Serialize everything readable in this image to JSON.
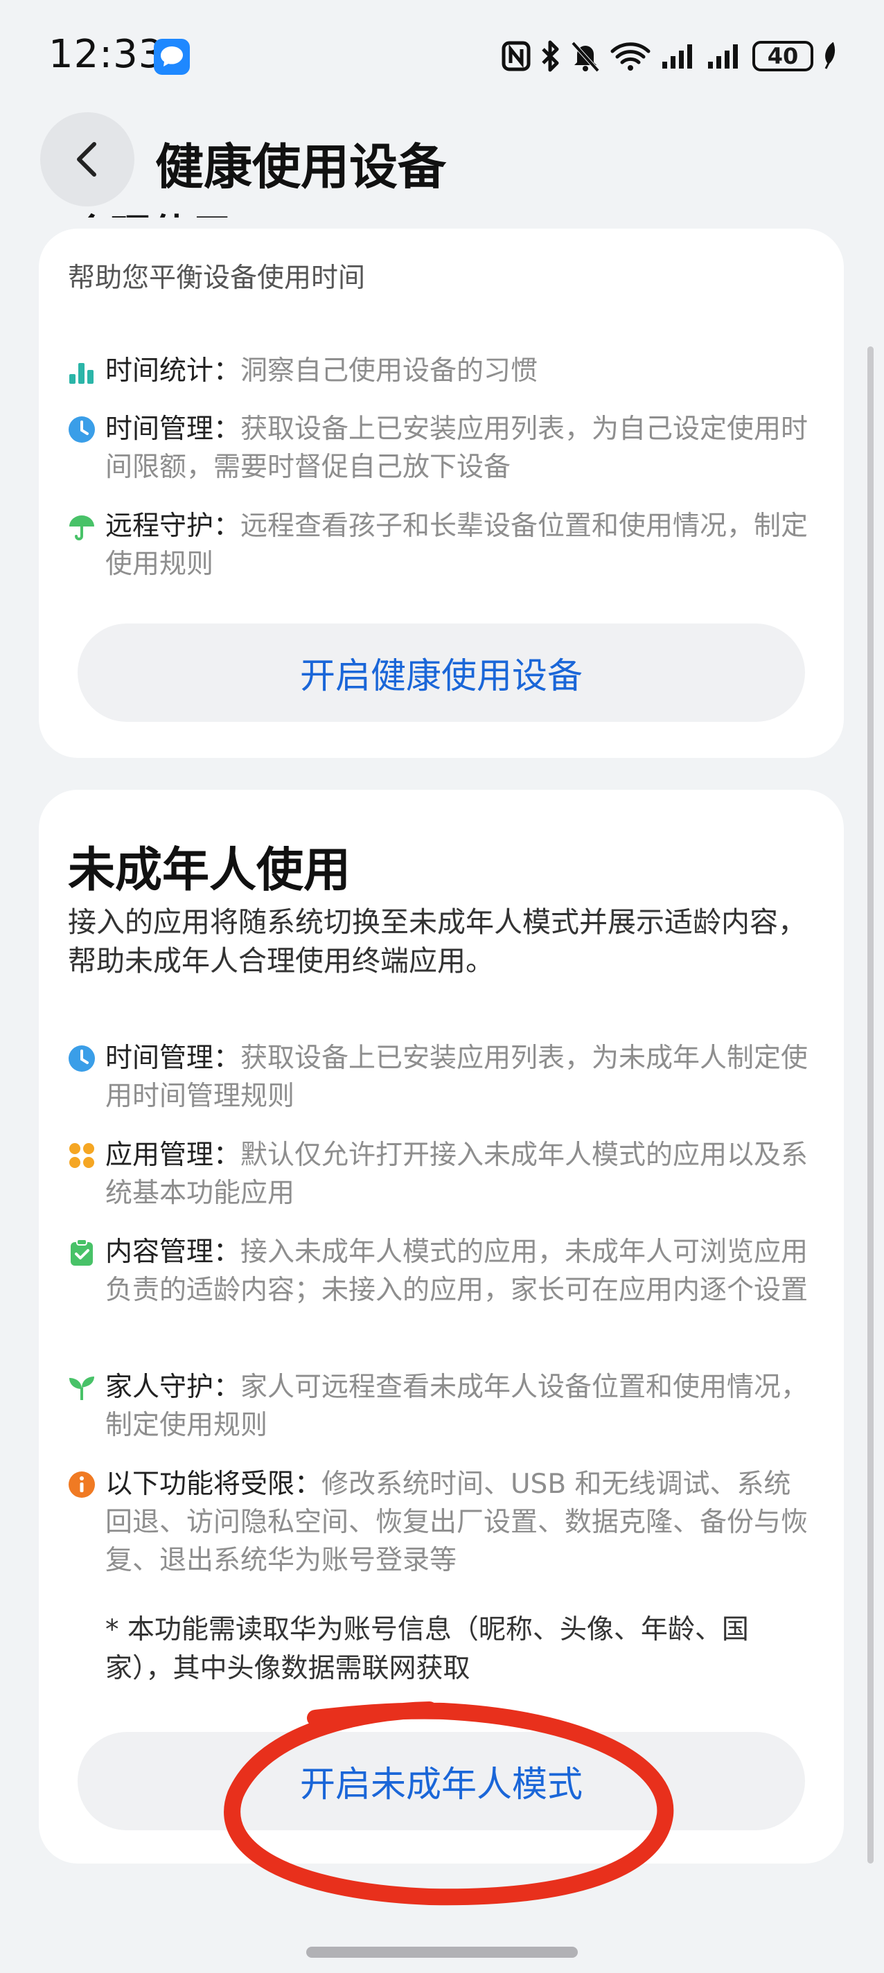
{
  "status_bar": {
    "time": "12:33",
    "battery": "40",
    "icons": [
      "message-icon",
      "nfc-icon",
      "bluetooth-icon",
      "bell-off-icon",
      "wifi-icon",
      "signal-icon",
      "signal-icon",
      "battery-icon",
      "leaf-icon"
    ]
  },
  "header": {
    "title": "健康使用设备"
  },
  "card1": {
    "title_cut": "合理使用",
    "subtitle": "帮助您平衡设备使用时间",
    "features": [
      {
        "icon": "bar-chart-icon",
        "label": "时间统计：",
        "text": "洞察自己使用设备的习惯"
      },
      {
        "icon": "clock-icon",
        "label": "时间管理：",
        "text": "获取设备上已安装应用列表，为自己设定使用时间限额，需要时督促自己放下设备"
      },
      {
        "icon": "umbrella-icon",
        "label": "远程守护：",
        "text": "远程查看孩子和长辈设备位置和使用情况，制定使用规则"
      }
    ],
    "button": "开启健康使用设备"
  },
  "card2": {
    "title": "未成年人使用",
    "description": "接入的应用将随系统切换至未成年人模式并展示适龄内容，帮助未成年人合理使用终端应用。",
    "features": [
      {
        "icon": "clock-icon",
        "label": "时间管理：",
        "text": "获取设备上已安装应用列表，为未成年人制定使用时间管理规则"
      },
      {
        "icon": "apps-icon",
        "label": "应用管理：",
        "text": "默认仅允许打开接入未成年人模式的应用以及系统基本功能应用"
      },
      {
        "icon": "clipboard-check-icon",
        "label": "内容管理：",
        "text": "接入未成年人模式的应用，未成年人可浏览应用负责的适龄内容；未接入的应用，家长可在应用内逐个设置"
      },
      {
        "icon": "sprout-icon",
        "label": "家人守护：",
        "text": "家人可远程查看未成年人设备位置和使用情况，制定使用规则"
      },
      {
        "icon": "info-icon",
        "label": "以下功能将受限：",
        "text": "修改系统时间、USB 和无线调试、系统回退、访问隐私空间、恢复出厂设置、数据克隆、备份与恢复、退出系统华为账号登录等"
      }
    ],
    "note": "* 本功能需读取华为账号信息（昵称、头像、年龄、国家），其中头像数据需联网获取",
    "button": "开启未成年人模式"
  },
  "colors": {
    "accent_blue": "#1a66d8",
    "teal": "#2bb5a8",
    "clock_blue": "#3a9ee8",
    "green": "#48c268",
    "orange": "#f5a623",
    "info_orange": "#f07a23",
    "annotation_red": "#e8301c"
  }
}
